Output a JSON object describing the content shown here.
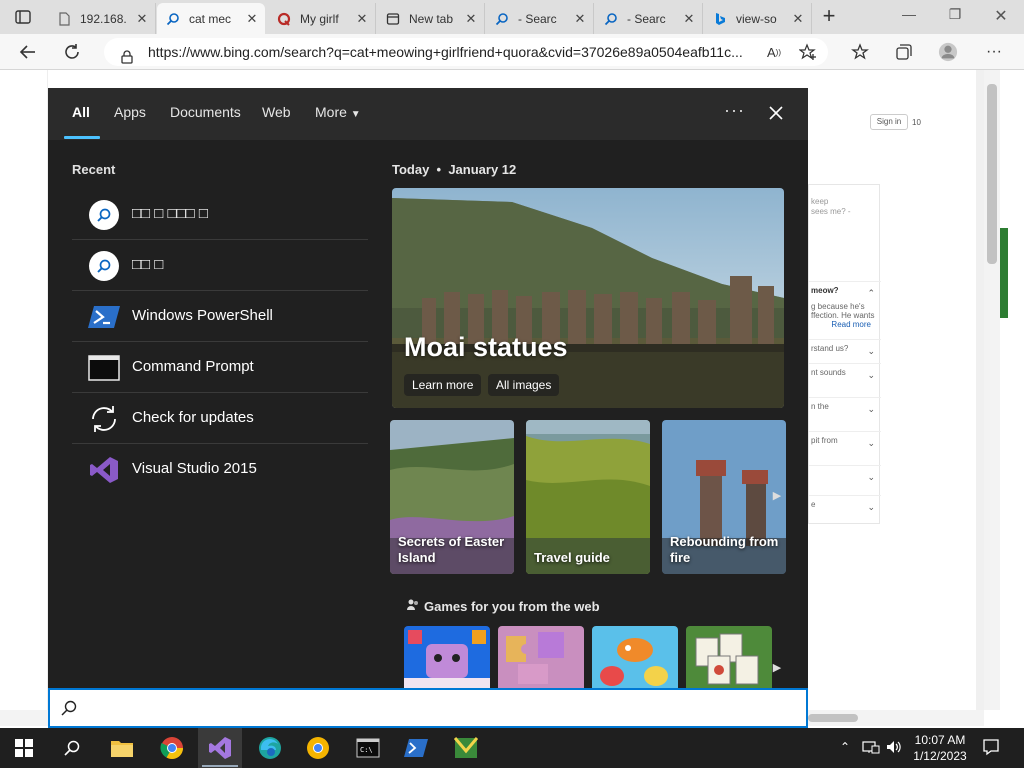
{
  "browser": {
    "tabs": [
      {
        "title": "192.168.",
        "icon": "page-icon"
      },
      {
        "title": "cat mec",
        "icon": "search-icon",
        "active": true
      },
      {
        "title": "My girlf",
        "icon": "quora-icon"
      },
      {
        "title": "New tab",
        "icon": "new-tab-icon"
      },
      {
        "title": "- Searc",
        "icon": "search-icon"
      },
      {
        "title": "- Searc",
        "icon": "search-icon"
      },
      {
        "title": "view-so",
        "icon": "bing-icon"
      }
    ],
    "url": "https://www.bing.com/search?q=cat+meowing+girlfriend+quora&cvid=37026e89a0504eafb11c..."
  },
  "background_page": {
    "sign_in": "Sign in",
    "count": "10",
    "panel_rows": [
      "keep",
      "sees me? -",
      "meow?",
      "g because he's",
      "ffection. He wants",
      "Read more",
      "rstand us?",
      "nt sounds",
      "n the",
      "pit from",
      "e"
    ]
  },
  "flyout": {
    "tabs": [
      "All",
      "Apps",
      "Documents",
      "Web",
      "More"
    ],
    "recent_heading": "Recent",
    "recent": [
      {
        "label": "□□ □ □□□ □",
        "icon": "search-icon"
      },
      {
        "label": "□□ □",
        "icon": "search-icon"
      },
      {
        "label": "Windows PowerShell",
        "icon": "powershell-icon"
      },
      {
        "label": "Command Prompt",
        "icon": "command-prompt-icon"
      },
      {
        "label": "Check for updates",
        "icon": "sync-icon"
      },
      {
        "label": "Visual Studio 2015",
        "icon": "visual-studio-icon"
      }
    ],
    "today": {
      "label": "Today",
      "date": "January 12"
    },
    "hero": {
      "title": "Moai statues",
      "learn_more": "Learn more",
      "all_images": "All images"
    },
    "cards": [
      "Secrets of Easter Island",
      "Travel guide",
      "Rebounding from fire"
    ],
    "games_heading": "Games for you from the web",
    "search_placeholder": ""
  },
  "taskbar": {
    "time": "10:07 AM",
    "date": "1/12/2023"
  }
}
